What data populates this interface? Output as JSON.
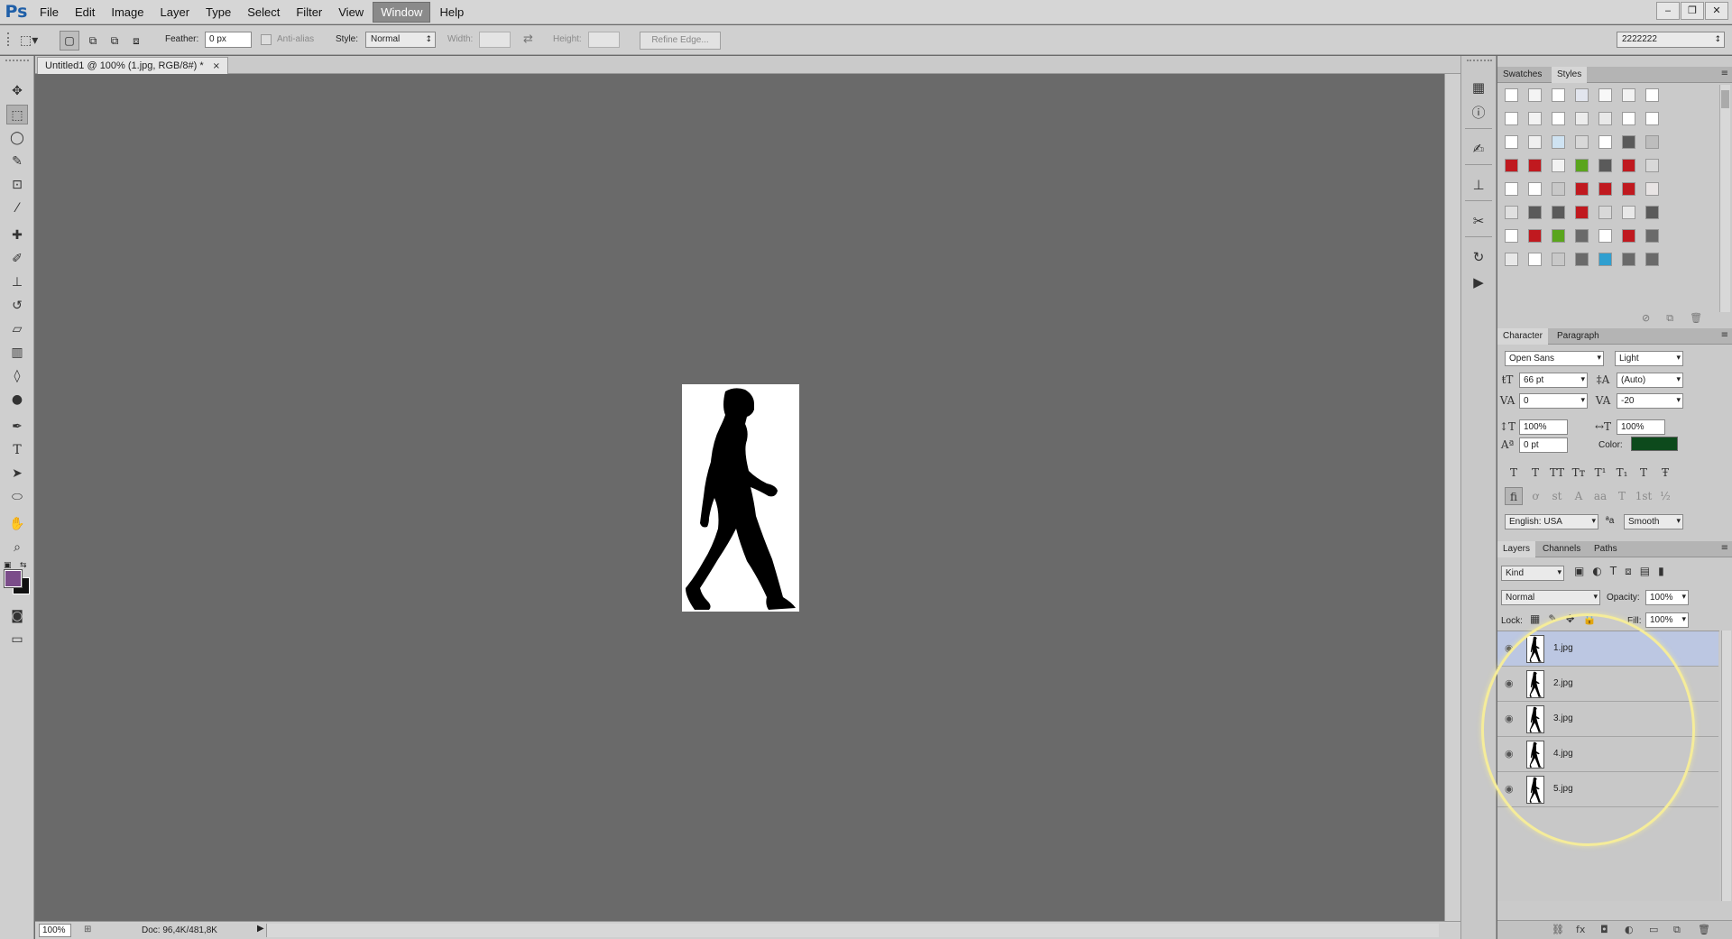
{
  "app": {
    "logo": "Ps",
    "window_controls": [
      "‒",
      "❐",
      "✕"
    ]
  },
  "menu": [
    "File",
    "Edit",
    "Image",
    "Layer",
    "Type",
    "Select",
    "Filter",
    "View",
    "Window",
    "Help"
  ],
  "menu_active": "Window",
  "options": {
    "feather_label": "Feather:",
    "feather_value": "0 px",
    "antialias_label": "Anti-alias",
    "style_label": "Style:",
    "style_value": "Normal",
    "width_label": "Width:",
    "height_label": "Height:",
    "refine_edge": "Refine Edge...",
    "workspace_value": "2222222"
  },
  "document": {
    "tab_title": "Untitled1 @ 100% (1.jpg, RGB/8#) *",
    "close": "×",
    "zoom": "100%",
    "doc_info": "Doc: 96,4K/481,8K"
  },
  "colors": {
    "foreground": "#7b4d8a",
    "background": "#111111",
    "character_color": "#0d4a1c",
    "panel_bg": "#cacaca",
    "canvas_bg": "#6a6a6a",
    "accent_red": "#c0191f",
    "accent_green": "#5aa51d",
    "accent_blue": "#2f9fd0",
    "highlight": "#f5ec9a"
  },
  "swatches_panel": {
    "tabs": [
      "Swatches",
      "Styles"
    ],
    "active": "Styles",
    "rows": [
      [
        "#ffffff",
        "#f4f4f4",
        "#ffffff",
        "#e2e5ee",
        "#f8f8f8",
        "#f2f2f2",
        "#ffffff"
      ],
      [
        "#ffffff",
        "#f2f2f2",
        "#ffffff",
        "#ececec",
        "#e8e8e8",
        "#ffffff",
        "#ffffff"
      ],
      [
        "#ffffff",
        "#f0f0f0",
        "#cfe3f2",
        "#d8d8d8",
        "#ffffff",
        "#5a5a5a",
        "#bdbdbd"
      ],
      [
        "#c0191f",
        "#c0191f",
        "#f2f2f2",
        "#5aa51d",
        "#5a5a5a",
        "#c0191f",
        "#d8d8d8"
      ],
      [
        "#ffffff",
        "#ffffff",
        "#c8c8c8",
        "#c0191f",
        "#c0191f",
        "#c0191f",
        "#e8e4e4"
      ],
      [
        "#e0e0e0",
        "#5a5a5a",
        "#5a5a5a",
        "#c0191f",
        "#d8d8d8",
        "#e8e8e8",
        "#5a5a5a"
      ],
      [
        "#ffffff",
        "#c0191f",
        "#5aa51d",
        "#6a6a6a",
        "#ffffff",
        "#c0191f",
        "#6a6a6a"
      ],
      [
        "#e8e8e8",
        "#ffffff",
        "#c8c8c8",
        "#6a6a6a",
        "#2f9fd0",
        "#6a6a6a",
        "#6a6a6a"
      ]
    ]
  },
  "character_panel": {
    "tabs": [
      "Character",
      "Paragraph"
    ],
    "active": "Character",
    "font_family": "Open Sans",
    "font_style": "Light",
    "size": "66 pt",
    "leading": "(Auto)",
    "kerning": "0",
    "tracking": "-20",
    "vscale": "100%",
    "hscale": "100%",
    "baseline": "0 pt",
    "color_label": "Color:",
    "language": "English: USA",
    "aa_icon": "ªa",
    "antialias": "Smooth",
    "type_buttons": [
      "T",
      "T",
      "TT",
      "Tт",
      "T¹",
      "T₁",
      "T",
      "Ŧ"
    ],
    "opentype_buttons": [
      "ﬁ",
      "ơ",
      "st",
      "A",
      "aa",
      "T",
      "1st",
      "½"
    ]
  },
  "layers_panel": {
    "tabs": [
      "Layers",
      "Channels",
      "Paths"
    ],
    "active": "Layers",
    "filter": "Kind",
    "blend_mode": "Normal",
    "opacity_label": "Opacity:",
    "opacity": "100%",
    "lock_label": "Lock:",
    "fill_label": "Fill:",
    "fill": "100%",
    "layers": [
      {
        "name": "1.jpg",
        "selected": true
      },
      {
        "name": "2.jpg",
        "selected": false
      },
      {
        "name": "3.jpg",
        "selected": false
      },
      {
        "name": "4.jpg",
        "selected": false
      },
      {
        "name": "5.jpg",
        "selected": false
      }
    ],
    "footer_icons": [
      "⛓",
      "fx",
      "◘",
      "◐",
      "▭",
      "⧉",
      "🗑"
    ]
  }
}
